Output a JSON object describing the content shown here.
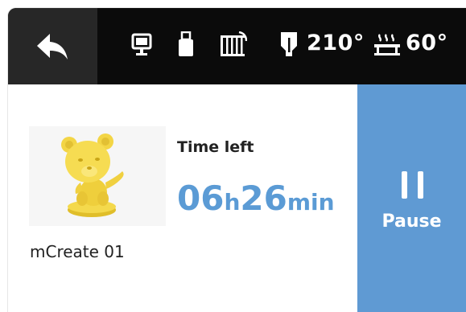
{
  "header": {
    "back_icon": "back-arrow-icon",
    "status_icons": [
      "monitor-icon",
      "usb-drive-icon",
      "enclosure-fan-icon",
      "nozzle-icon",
      "heated-bed-icon"
    ],
    "nozzle_temp": "210°",
    "bed_temp": "60°"
  },
  "job": {
    "model_name": "mCreate 01",
    "time_left_label": "Time left",
    "hours": "06",
    "hours_unit": "h",
    "minutes": "26",
    "minutes_unit": "min"
  },
  "pause_button": {
    "label": "Pause",
    "icon": "pause-icon",
    "color": "#5f9ad3"
  },
  "colors": {
    "accent": "#5b9bd5",
    "topbar": "#0b0b0b",
    "back_button": "#272727",
    "model": "#f2d442"
  }
}
